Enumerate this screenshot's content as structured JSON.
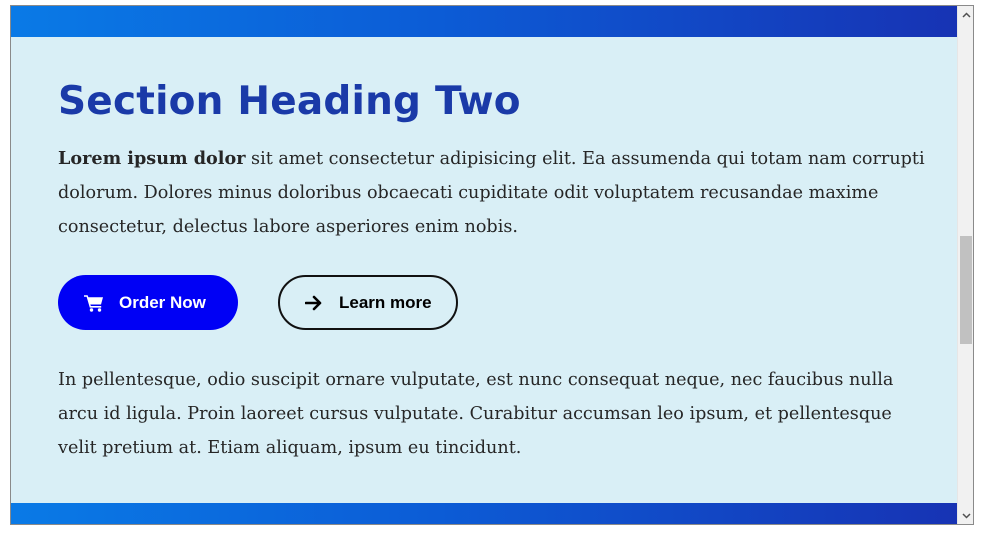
{
  "section": {
    "heading": "Section Heading Two",
    "intro_bold": "Lorem ipsum dolor",
    "intro_rest": " sit amet consectetur adipisicing elit. Ea assumenda qui totam nam corrupti dolorum. Dolores minus doloribus obcaecati cupiditate odit voluptatem recusandae maxime consectetur, delectus labore asperiores enim nobis.",
    "body": "In pellentesque, odio suscipit ornare vulputate, est nunc consequat neque, nec faucibus nulla arcu id ligula. Proin laoreet cursus vulputate. Curabitur accumsan leo ipsum, et pellentesque velit pretium at. Etiam aliquam, ipsum eu tincidunt."
  },
  "buttons": {
    "primary_label": "Order Now",
    "primary_icon": "shopping-cart-icon",
    "secondary_label": "Learn more",
    "secondary_icon": "arrow-right-icon"
  },
  "colors": {
    "heading": "#1a3aa8",
    "background": "#d9eff6",
    "primary_button": "#0000f5",
    "band_start": "#0a7ae6",
    "band_end": "#1733b4"
  }
}
